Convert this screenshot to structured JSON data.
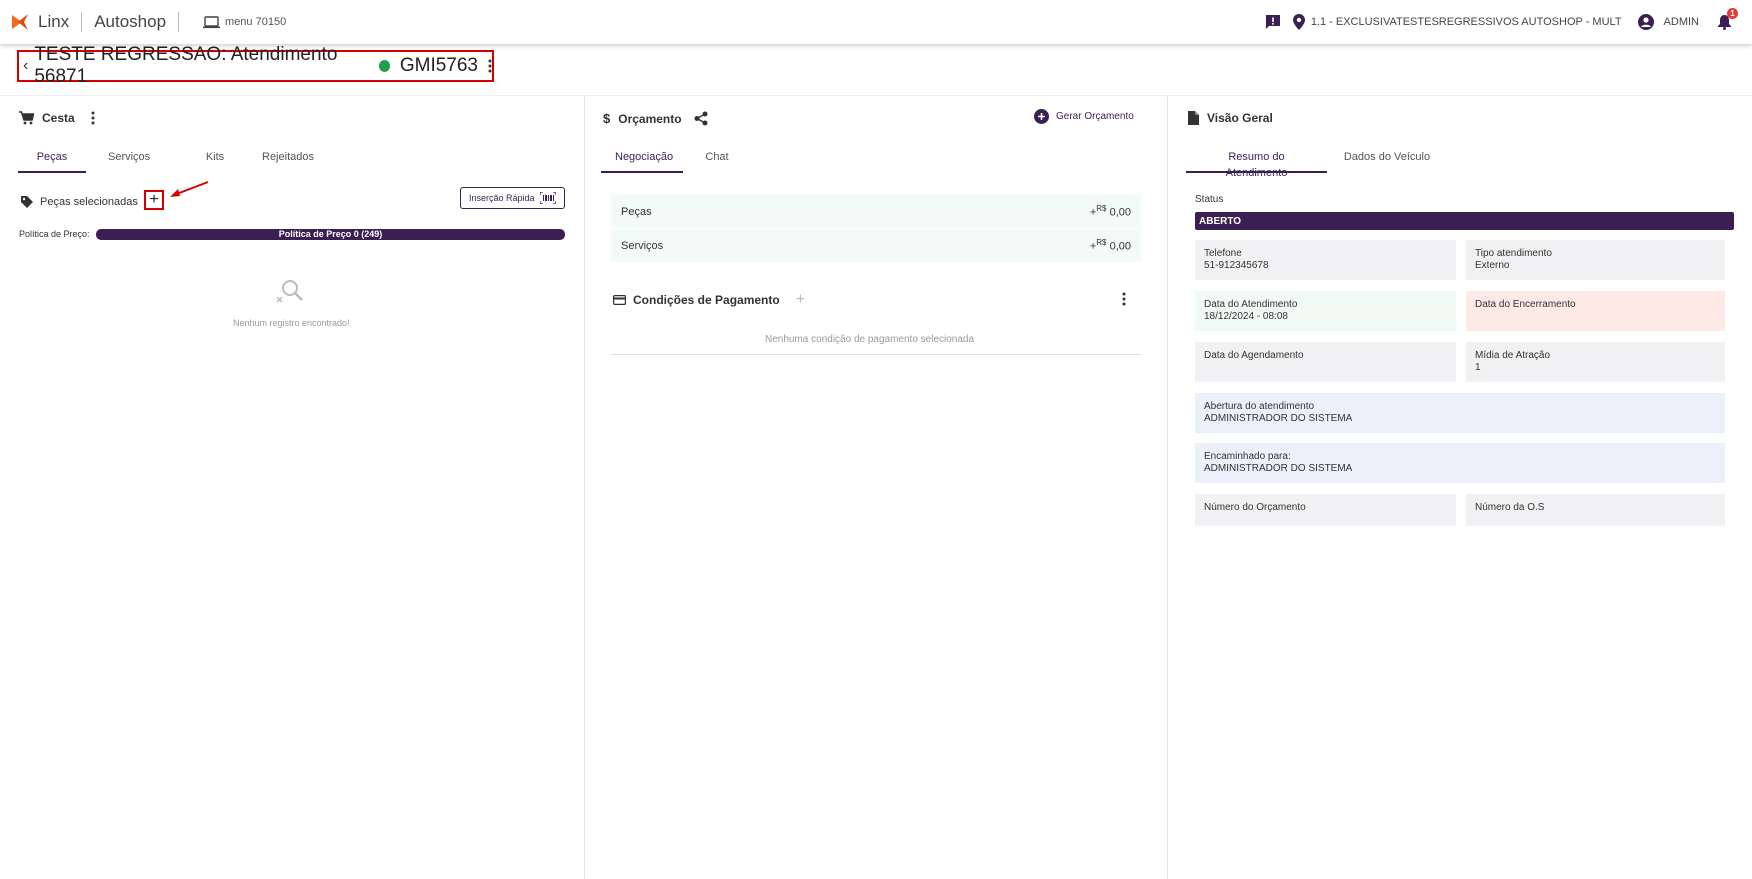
{
  "topbar": {
    "brand": "Linx",
    "product": "Autoshop",
    "menu_label": "menu 70150",
    "location": "1.1 - EXCLUSIVATESTESREGRESSIVOS AUTOSHOP - MULT",
    "user": "ADMIN",
    "notification_count": "1",
    "colors": {
      "logo": "#f26a21",
      "badge": "#e53935"
    }
  },
  "header": {
    "title": "TESTE REGRESSAO: Atendimento 56871",
    "plate": "GMI5763",
    "status_color": "#1e9e4f"
  },
  "cesta": {
    "title": "Cesta",
    "tabs": [
      "Peças",
      "Serviços",
      "Kits",
      "Rejeitados"
    ],
    "selected_label": "Peças selecionadas",
    "add_symbol": "+",
    "quick_insert": "Inserção Rápida",
    "policy_label": "Política de Preço:",
    "policy_value": "Política de Preço 0 (249)",
    "empty": "Nenhum registro encontrado!"
  },
  "orcamento": {
    "title": "Orçamento",
    "generate": "Gerar Orçamento",
    "tabs": [
      "Negociação",
      "Chat"
    ],
    "rows": [
      {
        "label": "Peças",
        "sign": "+",
        "currency": "R$",
        "value": "0,00"
      },
      {
        "label": "Serviços",
        "sign": "+",
        "currency": "R$",
        "value": "0,00"
      }
    ],
    "payment_title": "Condições de Pagamento",
    "payment_add": "+",
    "payment_empty": "Nenhuma condição de pagamento selecionada"
  },
  "visao": {
    "title": "Visão Geral",
    "tabs": [
      "Resumo do Atendimento",
      "Dados do Veículo"
    ],
    "status_label": "Status",
    "status_value": "ABERTO",
    "cards": {
      "telefone": {
        "label": "Telefone",
        "value": "51-912345678"
      },
      "tipo": {
        "label": "Tipo atendimento",
        "value": "Externo"
      },
      "data_atendimento": {
        "label": "Data do Atendimento",
        "value": "18/12/2024 - 08:08"
      },
      "data_encerramento": {
        "label": "Data do Encerramento",
        "value": ""
      },
      "data_agendamento": {
        "label": "Data do Agendamento",
        "value": ""
      },
      "midia": {
        "label": "Mídia de Atração",
        "value": "1"
      },
      "abertura": {
        "label": "Abertura do atendimento",
        "value": "ADMINISTRADOR DO SISTEMA"
      },
      "encaminhado": {
        "label": "Encaminhado para:",
        "value": "ADMINISTRADOR DO SISTEMA"
      },
      "num_orcamento": {
        "label": "Número do Orçamento",
        "value": ""
      },
      "num_os": {
        "label": "Número da O.S",
        "value": ""
      }
    }
  }
}
